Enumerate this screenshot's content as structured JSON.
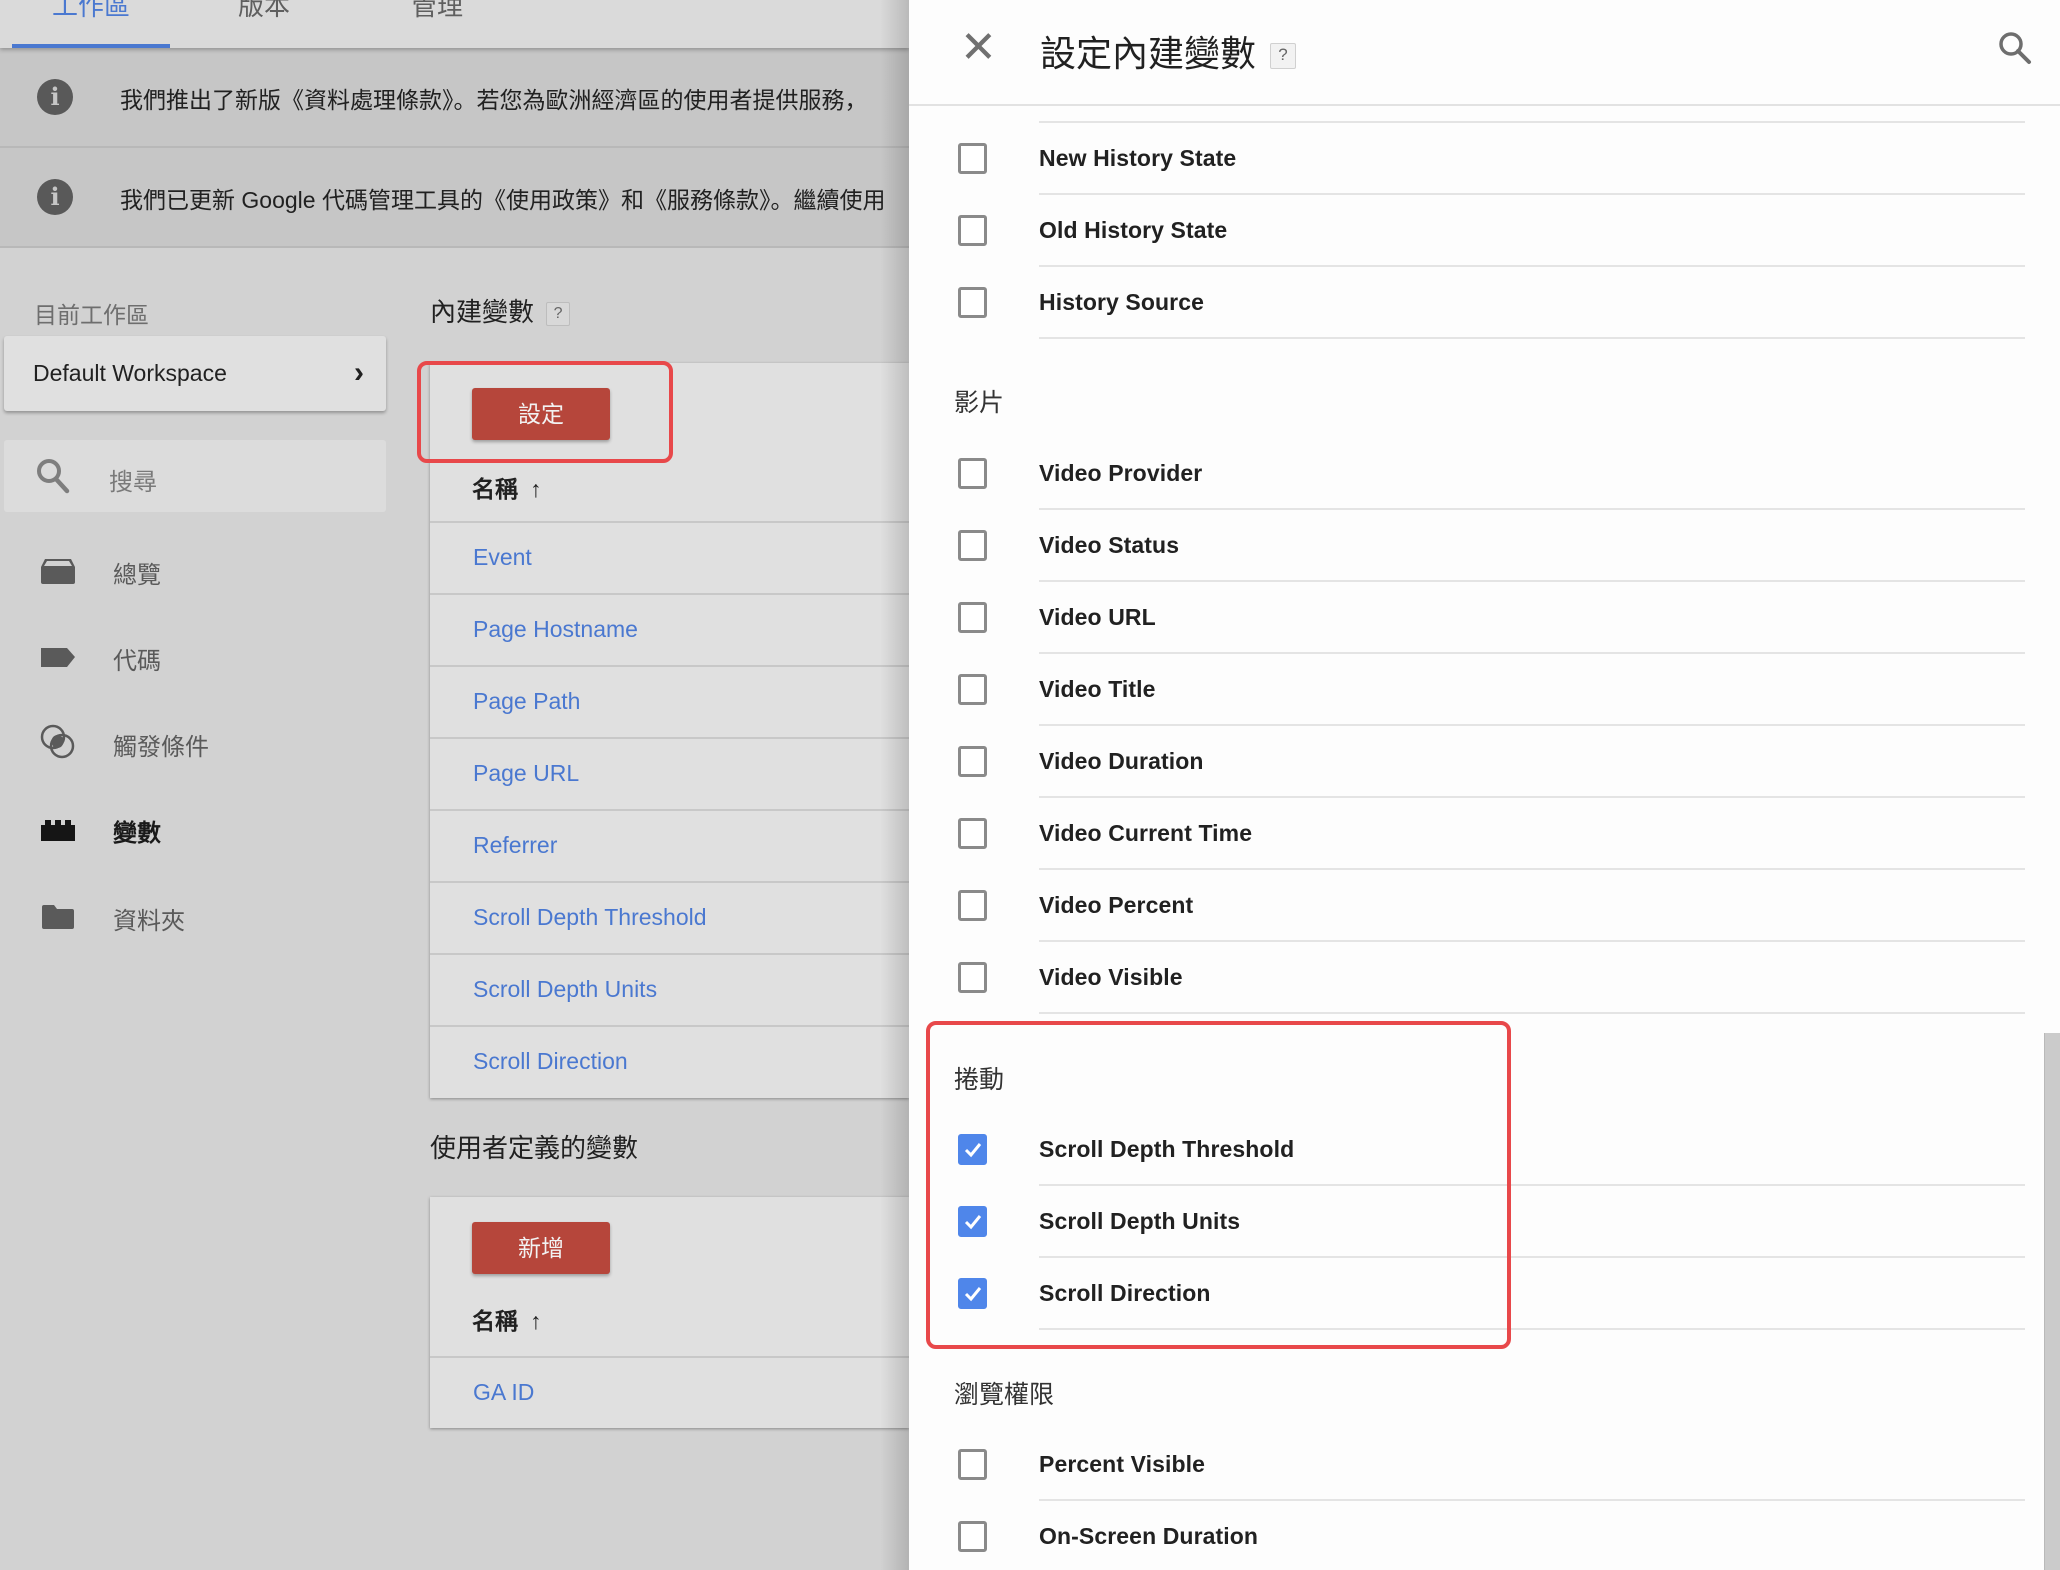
{
  "tabs": [
    {
      "label": "工作區",
      "active": true
    },
    {
      "label": "版本",
      "active": false
    },
    {
      "label": "管理",
      "active": false
    }
  ],
  "notices": [
    {
      "icon": "info-icon",
      "text": "我們推出了新版《資料處理條款》。若您為歐洲經濟區的使用者提供服務，"
    },
    {
      "icon": "info-icon",
      "text": "我們已更新 Google 代碼管理工具的《使用政策》和《服務條款》。繼續使用"
    }
  ],
  "sidebar": {
    "workspace_label": "目前工作區",
    "workspace_name": "Default Workspace",
    "search_placeholder": "搜尋",
    "items": [
      {
        "label": "總覽",
        "icon": "overview-icon",
        "active": false
      },
      {
        "label": "代碼",
        "icon": "tag-icon",
        "active": false
      },
      {
        "label": "觸發條件",
        "icon": "trigger-icon",
        "active": false
      },
      {
        "label": "變數",
        "icon": "variable-icon",
        "active": true
      },
      {
        "label": "資料夾",
        "icon": "folder-icon",
        "active": false
      }
    ]
  },
  "main": {
    "builtin": {
      "title": "內建變數",
      "help": "?",
      "configure_label": "設定",
      "column_header": "名稱",
      "sort_arrow": "↑",
      "rows": [
        "Event",
        "Page Hostname",
        "Page Path",
        "Page URL",
        "Referrer",
        "Scroll Depth Threshold",
        "Scroll Depth Units",
        "Scroll Direction"
      ]
    },
    "user_defined": {
      "title": "使用者定義的變數",
      "new_label": "新增",
      "column_header": "名稱",
      "sort_arrow": "↑",
      "rows": [
        "GA ID"
      ]
    }
  },
  "panel": {
    "title": "設定內建變數",
    "help": "?",
    "close": "✕",
    "groups": [
      {
        "title": null,
        "items": [
          {
            "label": "New History State",
            "checked": false
          },
          {
            "label": "Old History State",
            "checked": false
          },
          {
            "label": "History Source",
            "checked": false
          }
        ]
      },
      {
        "title": "影片",
        "items": [
          {
            "label": "Video Provider",
            "checked": false
          },
          {
            "label": "Video Status",
            "checked": false
          },
          {
            "label": "Video URL",
            "checked": false
          },
          {
            "label": "Video Title",
            "checked": false
          },
          {
            "label": "Video Duration",
            "checked": false
          },
          {
            "label": "Video Current Time",
            "checked": false
          },
          {
            "label": "Video Percent",
            "checked": false
          },
          {
            "label": "Video Visible",
            "checked": false
          }
        ]
      },
      {
        "title": "捲動",
        "items": [
          {
            "label": "Scroll Depth Threshold",
            "checked": true
          },
          {
            "label": "Scroll Depth Units",
            "checked": true
          },
          {
            "label": "Scroll Direction",
            "checked": true
          }
        ]
      },
      {
        "title": "瀏覽權限",
        "items": [
          {
            "label": "Percent Visible",
            "checked": false
          },
          {
            "label": "On-Screen Duration",
            "checked": false
          }
        ]
      }
    ]
  },
  "colors": {
    "accent_blue": "#4a78d0",
    "button_red": "#b6463b",
    "highlight_red": "#e8484a",
    "checkbox_blue": "#4f86ea"
  }
}
